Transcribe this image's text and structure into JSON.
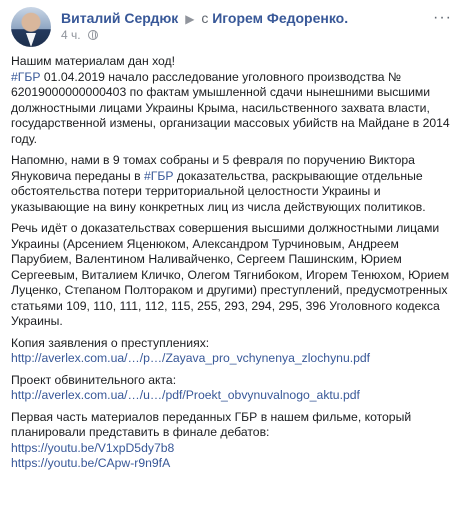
{
  "header": {
    "author": "Виталий Сердюк",
    "with_text": "с",
    "co_author": "Игорем Федоренко.",
    "time": "4 ч.",
    "menu": "···"
  },
  "paragraphs": {
    "p1_line1": "Нашим материалам дан ход!",
    "p1_hashtag": "#ГБР",
    "p1_rest": " 01.04.2019 начало расследование уголовного производства № 62019000000000403 по фактам умышленной сдачи нынешними высшими должностными лицами Украины Крыма, насильственного захвата власти, государственной измены, организации массовых убийств на Майдане в 2014 году.",
    "p2_start": "Напомню, нами в 9 томах собраны и 5 февраля по поручению Виктора Януковича переданы в ",
    "p2_hashtag": "#ГБР",
    "p2_rest": " доказательства, раскрывающие отдельные обстоятельства потери территориальной целостности Украины и указывающие на вину конкретных лиц из числа действующих политиков.",
    "p3": "Речь идёт о доказательствах совершения высшими должностными лицами Украины (Арсением Яценюком, Александром Турчиновым, Андреем Парубием, Валентином Наливайченко, Сергеем Пашинским, Юрием Сергеевым, Виталием Кличко, Олегом Тягнибоком, Игорем Тенюхом, Юрием Луценко, Степаном Полтораком и другими) преступлений, предусмотренных статьями 109, 110, 111, 112, 115, 255, 293, 294, 295, 396 Уголовного кодекса Украины.",
    "p4_label": "Копия заявления о преступлениях:",
    "p4_link": "http://averlex.com.ua/…/p…/Zayava_pro_vchynenya_zlochynu.pdf",
    "p5_label": "Проект обвинительного акта:",
    "p5_link": "http://averlex.com.ua/…/u…/pdf/Proekt_obvynuvalnogo_aktu.pdf",
    "p6_text": "Первая часть материалов переданных ГБР в нашем фильме, который планировали представить в финале дебатов:",
    "p6_link1": "https://youtu.be/V1xpD5dy7b8",
    "p6_link2": "https://youtu.be/CApw-r9n9fA"
  },
  "colors": {
    "link": "#385898",
    "text": "#1c1e21",
    "meta": "#90949c"
  }
}
